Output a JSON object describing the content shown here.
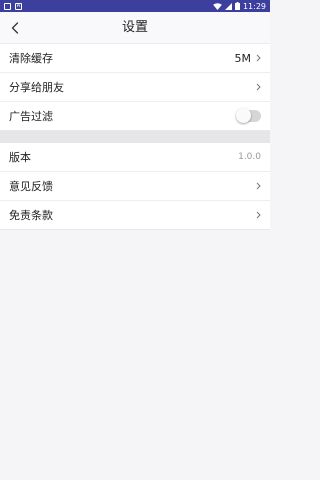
{
  "status_bar": {
    "time": "11:29",
    "left_icons": [
      "notification-box-icon",
      "accessibility-icon"
    ],
    "right_icons": [
      "wifi-icon",
      "signal-icon",
      "battery-icon"
    ],
    "color": "#3c3f9e"
  },
  "nav": {
    "title": "设置",
    "back_icon": "chevron-left-icon"
  },
  "group1": {
    "clear_cache": {
      "label": "清除缓存",
      "value": "5M"
    },
    "share": {
      "label": "分享给朋友"
    },
    "ad_filter": {
      "label": "广告过滤",
      "enabled": false
    }
  },
  "group2": {
    "version": {
      "label": "版本",
      "value": "1.0.0"
    },
    "feedback": {
      "label": "意见反馈"
    },
    "disclaimer": {
      "label": "免责条款"
    }
  }
}
